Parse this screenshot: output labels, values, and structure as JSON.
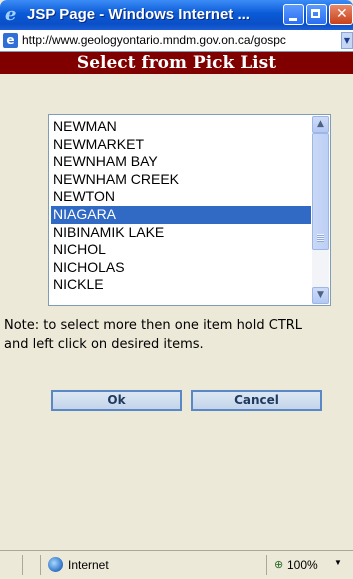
{
  "window": {
    "title": "JSP Page - Windows Internet ...",
    "url": "http://www.geologyontario.mndm.gov.on.ca/gospc"
  },
  "page": {
    "header": "Select from Pick List",
    "list_items": [
      "NEWMAN",
      "NEWMARKET",
      "NEWNHAM BAY",
      "NEWNHAM CREEK",
      "NEWTON",
      "NIAGARA",
      "NIBINAMIK LAKE",
      "NICHOL",
      "NICHOLAS",
      "NICKLE"
    ],
    "selected_item": "NIAGARA",
    "note": "Note: to select more then one item hold CTRL and left click on desired items.",
    "ok_label": "Ok",
    "cancel_label": "Cancel"
  },
  "statusbar": {
    "zone": "Internet",
    "zoom": "100%"
  },
  "colors": {
    "header_bg": "#800000",
    "selection": "#316ac5"
  }
}
